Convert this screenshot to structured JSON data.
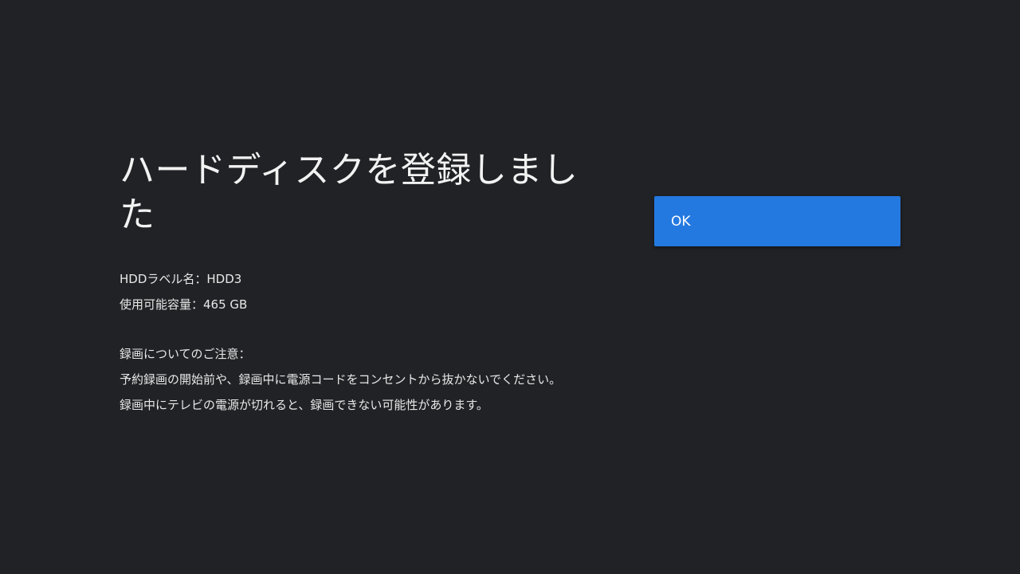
{
  "dialog": {
    "title": "ハードディスクを登録しました",
    "hdd_label_line": "HDDラベル名：HDD3",
    "capacity_line": "使用可能容量：465 GB",
    "notice_heading": "録画についてのご注意：",
    "notice_line_1": "予約録画の開始前や、録画中に電源コードをコンセントから抜かないでください。",
    "notice_line_2": "録画中にテレビの電源が切れると、録画できない可能性があります。"
  },
  "actions": {
    "ok_label": "OK"
  },
  "colors": {
    "background": "#212226",
    "button": "#2479e0",
    "text": "#ffffff"
  }
}
